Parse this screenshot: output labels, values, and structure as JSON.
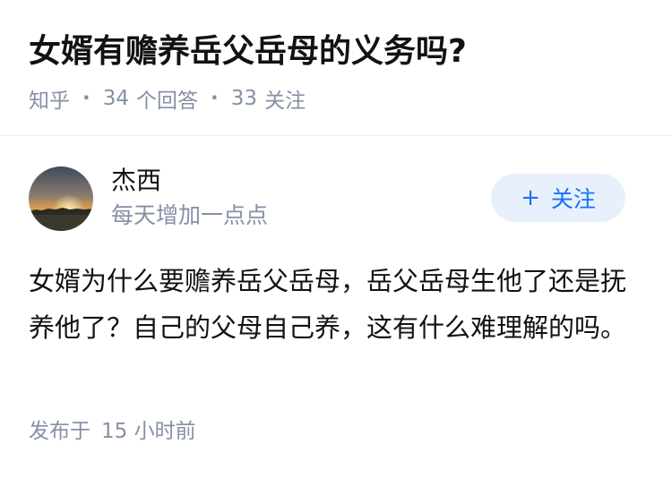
{
  "question": {
    "title": "女婿有赡养岳父岳母的义务吗?",
    "source": "知乎",
    "answer_count": "34",
    "answer_label": "个回答",
    "follower_count": "33",
    "follower_label": "关注"
  },
  "answer": {
    "author": {
      "name": "杰西",
      "bio": "每天增加一点点",
      "avatar_icon": "sunset-avatar"
    },
    "follow_button": {
      "icon": "+",
      "label": "关注"
    },
    "content": "女婿为什么要赡养岳父岳母，岳父岳母生他了还是抚养他了？自己的父母自己养，这有什么难理解的吗。",
    "time_prefix": "发布于",
    "time_value": "15 小时前"
  },
  "colors": {
    "text_primary": "#121212",
    "text_secondary": "#8590a6",
    "accent": "#1772f6",
    "follow_bg": "#e8f1fb"
  }
}
